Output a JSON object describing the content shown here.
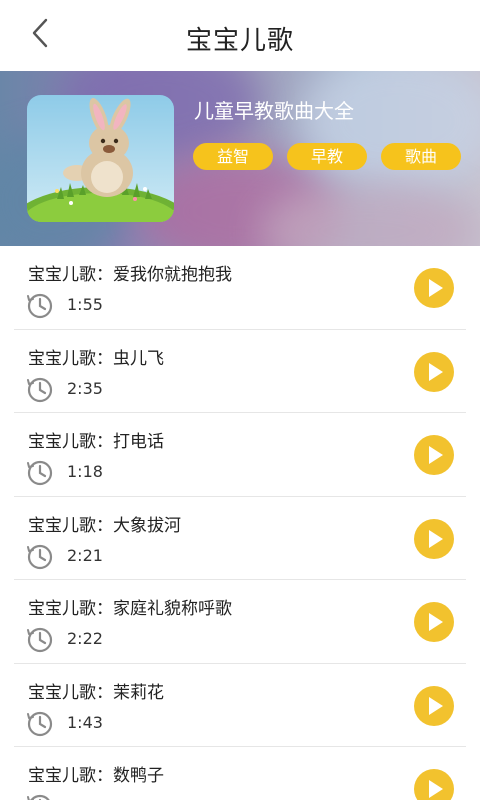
{
  "header": {
    "title": "宝宝儿歌"
  },
  "album": {
    "title": "儿童早教歌曲大全",
    "tags": [
      "益智",
      "早教",
      "歌曲"
    ]
  },
  "songs": [
    {
      "title": "宝宝儿歌：爱我你就抱抱我",
      "duration": "1:55"
    },
    {
      "title": "宝宝儿歌：虫儿飞",
      "duration": "2:35"
    },
    {
      "title": "宝宝儿歌：打电话",
      "duration": "1:18"
    },
    {
      "title": "宝宝儿歌：大象拔河",
      "duration": "2:21"
    },
    {
      "title": "宝宝儿歌：家庭礼貌称呼歌",
      "duration": "2:22"
    },
    {
      "title": "宝宝儿歌：茉莉花",
      "duration": "1:43"
    },
    {
      "title": "宝宝儿歌：数鸭子",
      "duration": ""
    }
  ],
  "colors": {
    "accent": "#f6c31c",
    "play_button": "#f2c22e",
    "clock_icon": "#8a8a8a"
  },
  "icons": {
    "back": "chevron-left-icon",
    "clock": "clock-icon",
    "play": "play-icon"
  }
}
